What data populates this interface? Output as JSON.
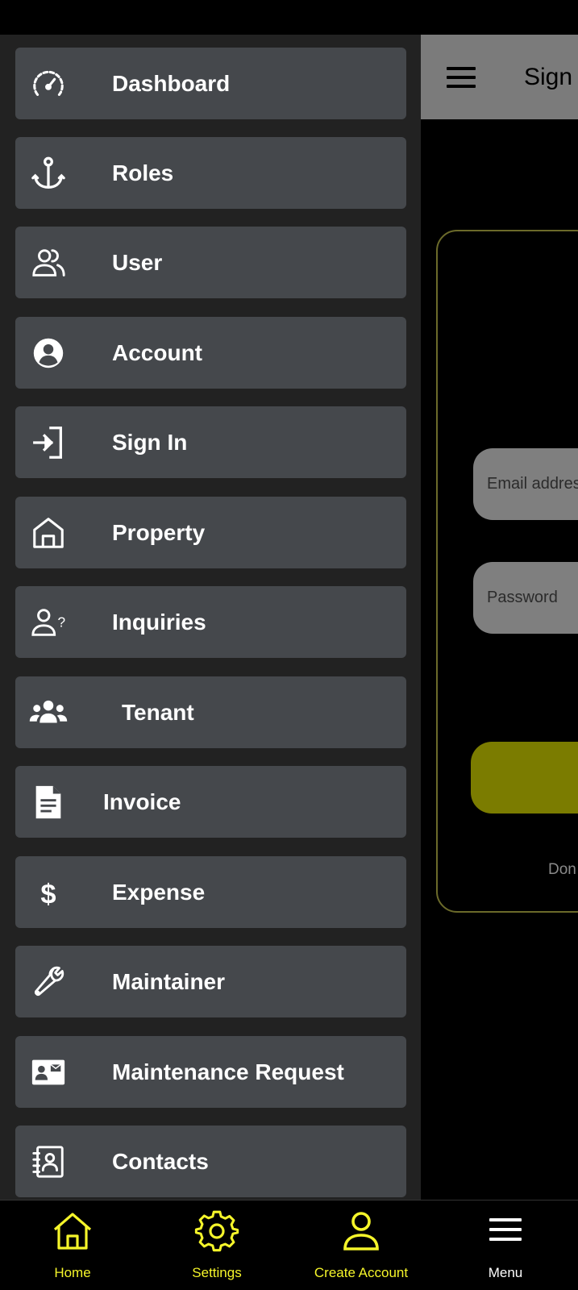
{
  "background": {
    "appbar_title": "Sign",
    "email_placeholder": "Email addres",
    "password_placeholder": "Password",
    "footer_text": "Don"
  },
  "drawer": {
    "items": [
      {
        "label": "Dashboard",
        "icon": "speedometer-icon"
      },
      {
        "label": "Roles",
        "icon": "anchor-icon"
      },
      {
        "label": "User",
        "icon": "users-icon"
      },
      {
        "label": "Account",
        "icon": "account-circle-icon"
      },
      {
        "label": "Sign In",
        "icon": "sign-in-icon"
      },
      {
        "label": "Property",
        "icon": "house-icon"
      },
      {
        "label": "Inquiries",
        "icon": "person-question-icon"
      },
      {
        "label": "Tenant",
        "icon": "group-icon"
      },
      {
        "label": "Invoice",
        "icon": "document-icon"
      },
      {
        "label": "Expense",
        "icon": "dollar-icon"
      },
      {
        "label": "Maintainer",
        "icon": "wrench-icon"
      },
      {
        "label": "Maintenance Request",
        "icon": "contact-card-icon"
      },
      {
        "label": "Contacts",
        "icon": "contacts-book-icon"
      }
    ]
  },
  "bottom_nav": {
    "home": "Home",
    "settings": "Settings",
    "create_account": "Create Account",
    "menu": "Menu"
  },
  "colors": {
    "accent_yellow": "#f5f52a",
    "drawer_bg": "#222222",
    "item_bg": "#45484c",
    "button_olive": "#7b7c00"
  }
}
